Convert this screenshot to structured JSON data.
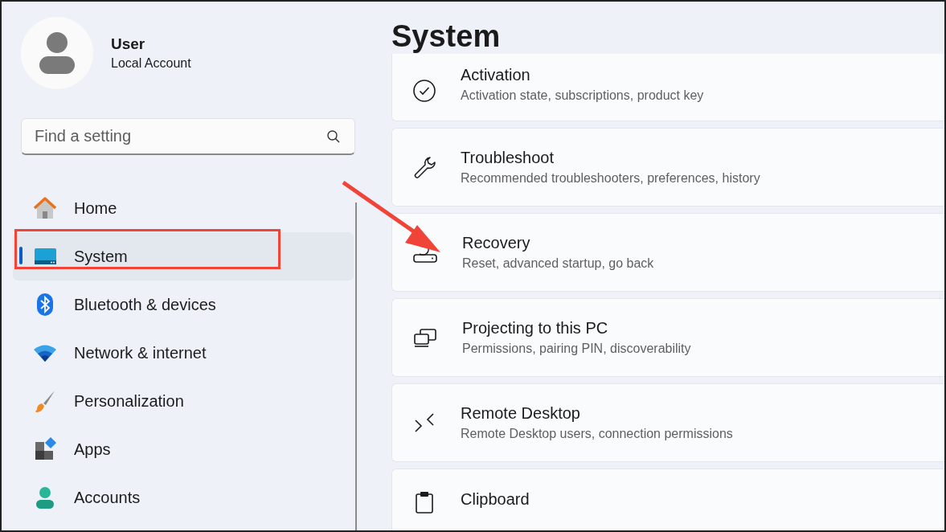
{
  "user": {
    "name": "User",
    "account": "Local Account"
  },
  "search": {
    "placeholder": "Find a setting"
  },
  "nav": [
    {
      "label": "Home",
      "kind": "home",
      "selected": false
    },
    {
      "label": "System",
      "kind": "system",
      "selected": true
    },
    {
      "label": "Bluetooth & devices",
      "kind": "bluetooth",
      "selected": false
    },
    {
      "label": "Network & internet",
      "kind": "network",
      "selected": false
    },
    {
      "label": "Personalization",
      "kind": "brush",
      "selected": false
    },
    {
      "label": "Apps",
      "kind": "apps",
      "selected": false
    },
    {
      "label": "Accounts",
      "kind": "accounts",
      "selected": false
    }
  ],
  "page_title": "System",
  "cards": [
    {
      "title": "Activation",
      "description": "Activation state, subscriptions, product key",
      "kind": "check"
    },
    {
      "title": "Troubleshoot",
      "description": "Recommended troubleshooters, preferences, history",
      "kind": "wrench"
    },
    {
      "title": "Recovery",
      "description": "Reset, advanced startup, go back",
      "kind": "recovery"
    },
    {
      "title": "Projecting to this PC",
      "description": "Permissions, pairing PIN, discoverability",
      "kind": "project"
    },
    {
      "title": "Remote Desktop",
      "description": "Remote Desktop users, connection permissions",
      "kind": "remote"
    },
    {
      "title": "Clipboard",
      "kind": "clipboard"
    }
  ],
  "annotations": {
    "highlight_selected": true,
    "arrow": true
  }
}
